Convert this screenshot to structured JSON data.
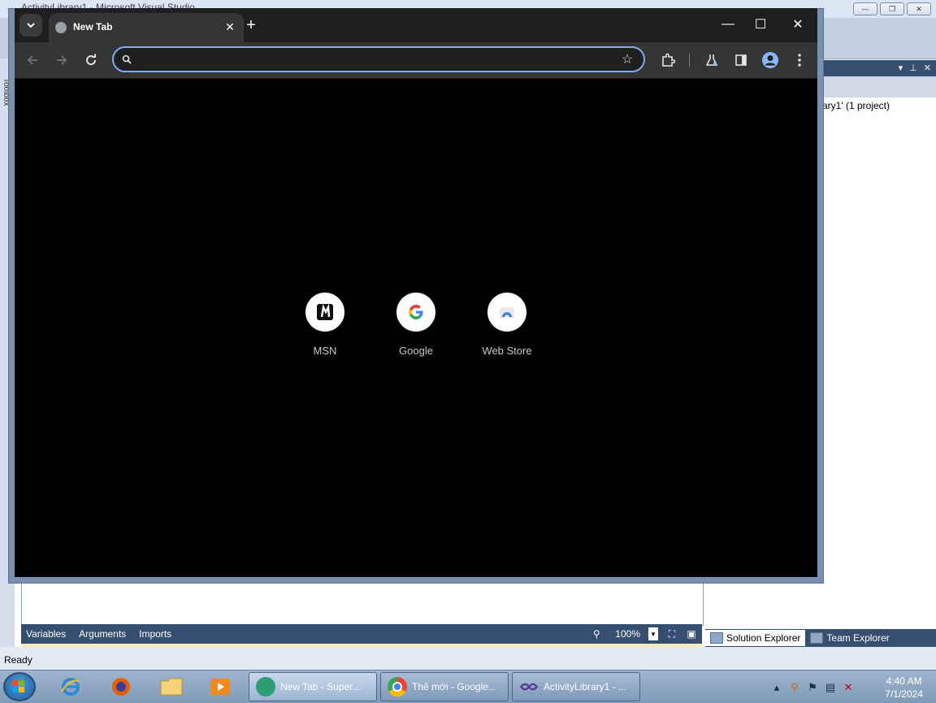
{
  "vs": {
    "title": "ActivityLibrary1 - Microsoft Visual Studio",
    "toolbox_tab": "Toolbox",
    "designer_tabs": [
      "Variables",
      "Arguments",
      "Imports"
    ],
    "zoom_value": "100%",
    "solution_text": "ary1' (1 project)",
    "side_tabs": [
      {
        "label": "Solution Explorer",
        "icon": "solution-explorer-icon"
      },
      {
        "label": "Team Explorer",
        "icon": "team-explorer-icon"
      }
    ],
    "status": "Ready"
  },
  "chrome": {
    "tab_title": "New Tab",
    "omnibox": {
      "value": "",
      "placeholder": ""
    },
    "shortcuts": [
      {
        "label": "MSN",
        "icon": "msn-icon"
      },
      {
        "label": "Google",
        "icon": "google-icon"
      },
      {
        "label": "Web Store",
        "icon": "web-store-icon"
      }
    ],
    "colors": {
      "accent": "#7cacf8",
      "background": "#000000",
      "toolbar": "#353535"
    }
  },
  "taskbar": {
    "tasks": [
      {
        "label": "New Tab - Super...",
        "icon": "super-browser-icon"
      },
      {
        "label": "Thẻ mới - Google...",
        "icon": "chrome-icon"
      },
      {
        "label": "ActivityLibrary1 - ...",
        "icon": "visual-studio-icon"
      }
    ],
    "clock": {
      "time": "4:40 AM",
      "date": "7/1/2024"
    }
  }
}
